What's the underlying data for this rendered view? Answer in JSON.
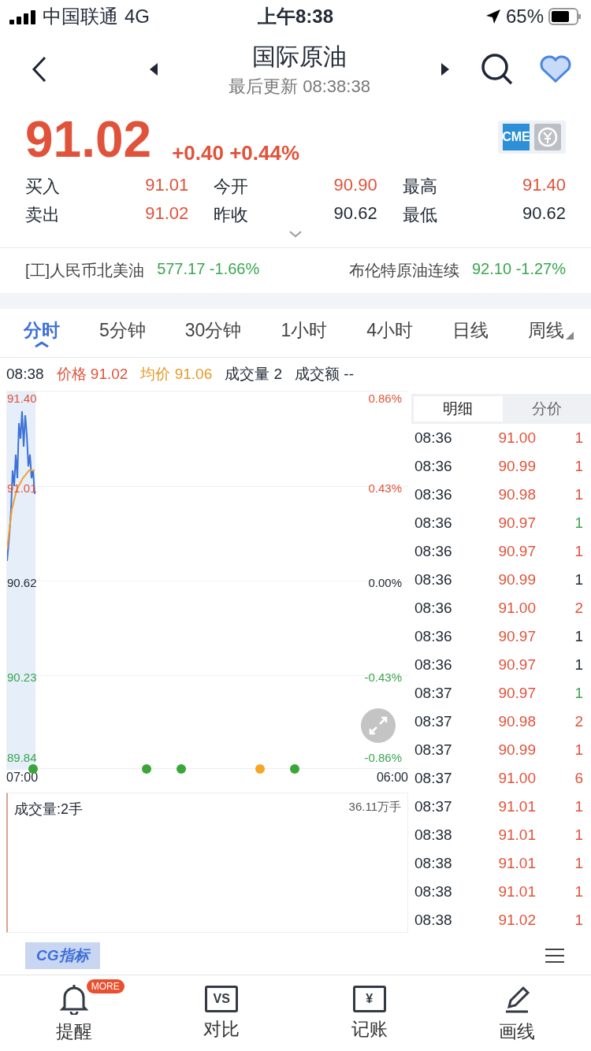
{
  "status_bar": {
    "carrier": "中国联通",
    "network": "4G",
    "time": "上午8:38",
    "battery": "65%"
  },
  "header": {
    "title": "国际原油",
    "subtitle": "最后更新 08:38:38"
  },
  "quote": {
    "price": "91.02",
    "change": "+0.40",
    "change_pct": "+0.44%",
    "exchange_logo": "CME",
    "stats": [
      {
        "label": "买入",
        "value": "91.01",
        "color": "#e0533a"
      },
      {
        "label": "今开",
        "value": "90.90",
        "color": "#e0533a"
      },
      {
        "label": "最高",
        "value": "91.40",
        "color": "#e0533a"
      },
      {
        "label": "卖出",
        "value": "91.02",
        "color": "#e0533a"
      },
      {
        "label": "昨收",
        "value": "90.62",
        "color": "#222a36"
      },
      {
        "label": "最低",
        "value": "90.62",
        "color": "#222a36"
      }
    ]
  },
  "related": [
    {
      "name": "[工]人民币北美油",
      "price": "577.17",
      "pct": "-1.66%",
      "color": "#3aa64f"
    },
    {
      "name": "布伦特原油连续",
      "price": "92.10",
      "pct": "-1.27%",
      "color": "#3aa64f"
    }
  ],
  "period_tabs": [
    {
      "label": "分时",
      "selected": true,
      "kind": "plain"
    },
    {
      "label": "5分钟",
      "selected": false,
      "kind": "plain"
    },
    {
      "label": "30分钟",
      "selected": false,
      "kind": "plain"
    },
    {
      "label": "1小时",
      "selected": false,
      "kind": "plain"
    },
    {
      "label": "4小时",
      "selected": false,
      "kind": "plain"
    },
    {
      "label": "日线",
      "selected": false,
      "kind": "plain"
    },
    {
      "label": "周线",
      "selected": false,
      "kind": "dropdown"
    }
  ],
  "info_line": {
    "time": "08:38",
    "price_label": "价格",
    "price": "91.02",
    "avg_label": "均价",
    "avg": "91.06",
    "volume": "成交量 2",
    "amount": "成交额 --"
  },
  "chart": {
    "price_labels": [
      {
        "text": "91.40",
        "color": "#e0533a"
      },
      {
        "text": "91.01",
        "color": "#e0533a"
      },
      {
        "text": "90.62",
        "color": "#222a36"
      },
      {
        "text": "90.23",
        "color": "#3aa64f"
      },
      {
        "text": "89.84",
        "color": "#3aa64f"
      }
    ],
    "pct_labels": [
      {
        "text": "0.86%",
        "color": "#e0533a"
      },
      {
        "text": "0.43%",
        "color": "#e0533a"
      },
      {
        "text": "0.00%",
        "color": "#222a36"
      },
      {
        "text": "-0.43%",
        "color": "#3aa64f"
      },
      {
        "text": "-0.86%",
        "color": "#3aa64f"
      }
    ],
    "time_start": "07:00",
    "time_end": "06:00",
    "events": [
      {
        "color": "#3aa63a"
      },
      {
        "color": "#3aa63a"
      },
      {
        "color": "#3aa63a"
      },
      {
        "color": "#f5a623"
      },
      {
        "color": "#3aa63a"
      }
    ]
  },
  "volume_panel": {
    "label": "成交量:2手",
    "max": "36.11万手"
  },
  "detail_tabs": [
    {
      "label": "明细",
      "selected": true
    },
    {
      "label": "分价",
      "selected": false
    }
  ],
  "trades": [
    {
      "time": "08:36",
      "price": "91.00",
      "qty": "1",
      "color": "#e0533a"
    },
    {
      "time": "08:36",
      "price": "90.99",
      "qty": "1",
      "color": "#e0533a"
    },
    {
      "time": "08:36",
      "price": "90.98",
      "qty": "1",
      "color": "#e0533a"
    },
    {
      "time": "08:36",
      "price": "90.97",
      "qty": "1",
      "color": "#3aa64f"
    },
    {
      "time": "08:36",
      "price": "90.97",
      "qty": "1",
      "color": "#e0533a"
    },
    {
      "time": "08:36",
      "price": "90.99",
      "qty": "1",
      "color": "#222a36"
    },
    {
      "time": "08:36",
      "price": "91.00",
      "qty": "2",
      "color": "#e0533a"
    },
    {
      "time": "08:36",
      "price": "90.97",
      "qty": "1",
      "color": "#222a36"
    },
    {
      "time": "08:36",
      "price": "90.97",
      "qty": "1",
      "color": "#222a36"
    },
    {
      "time": "08:37",
      "price": "90.97",
      "qty": "1",
      "color": "#3aa64f"
    },
    {
      "time": "08:37",
      "price": "90.98",
      "qty": "2",
      "color": "#e0533a"
    },
    {
      "time": "08:37",
      "price": "90.99",
      "qty": "1",
      "color": "#e0533a"
    },
    {
      "time": "08:37",
      "price": "91.00",
      "qty": "6",
      "color": "#e0533a"
    },
    {
      "time": "08:37",
      "price": "91.01",
      "qty": "1",
      "color": "#e0533a"
    },
    {
      "time": "08:38",
      "price": "91.01",
      "qty": "1",
      "color": "#e0533a"
    },
    {
      "time": "08:38",
      "price": "91.01",
      "qty": "1",
      "color": "#e0533a"
    },
    {
      "time": "08:38",
      "price": "91.01",
      "qty": "1",
      "color": "#e0533a"
    },
    {
      "time": "08:38",
      "price": "91.02",
      "qty": "1",
      "color": "#e0533a"
    }
  ],
  "indicator_button": "CG指标",
  "bottom_nav": [
    {
      "kind": "bell",
      "label": "提醒",
      "badge": "MORE"
    },
    {
      "kind": "vs",
      "label": "对比",
      "icon_text": "VS"
    },
    {
      "kind": "ledger",
      "label": "记账",
      "icon_text": "¥"
    },
    {
      "kind": "pen",
      "label": "画线"
    }
  ]
}
